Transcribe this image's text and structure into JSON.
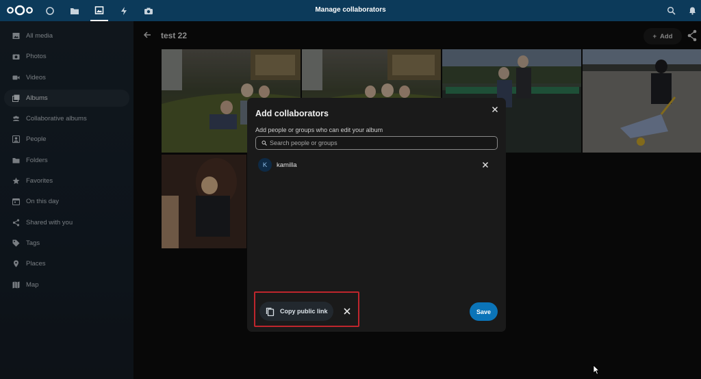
{
  "header": {
    "title": "Manage collaborators",
    "logo_icon": "nextcloud-logo",
    "apps": [
      {
        "name": "dashboard-icon",
        "active": false
      },
      {
        "name": "files-icon",
        "active": false
      },
      {
        "name": "photos-icon",
        "active": true
      },
      {
        "name": "activity-icon",
        "active": false
      },
      {
        "name": "camera-icon",
        "active": false
      }
    ],
    "right_icons": [
      "search-icon",
      "bell-icon"
    ]
  },
  "sidebar": {
    "items": [
      {
        "label": "All media",
        "icon": "image-icon",
        "active": false
      },
      {
        "label": "Photos",
        "icon": "camera-icon",
        "active": false
      },
      {
        "label": "Videos",
        "icon": "video-icon",
        "active": false
      },
      {
        "label": "Albums",
        "icon": "albums-icon",
        "active": true
      },
      {
        "label": "Collaborative albums",
        "icon": "group-icon",
        "active": false
      },
      {
        "label": "People",
        "icon": "people-icon",
        "active": false
      },
      {
        "label": "Folders",
        "icon": "folder-icon",
        "active": false
      },
      {
        "label": "Favorites",
        "icon": "star-icon",
        "active": false
      },
      {
        "label": "On this day",
        "icon": "calendar-icon",
        "active": false
      },
      {
        "label": "Shared with you",
        "icon": "share-icon",
        "active": false
      },
      {
        "label": "Tags",
        "icon": "tag-icon",
        "active": false
      },
      {
        "label": "Places",
        "icon": "pin-icon",
        "active": false
      },
      {
        "label": "Map",
        "icon": "map-icon",
        "active": false
      }
    ]
  },
  "album": {
    "title": "test 22",
    "add_label": "Add"
  },
  "modal": {
    "title": "Add collaborators",
    "subtitle": "Add people or groups who can edit your album",
    "search_placeholder": "Search people or groups",
    "search_value": "",
    "collaborators": [
      {
        "initial": "K",
        "name": "kamilla"
      }
    ],
    "copy_link_label": "Copy public link",
    "save_label": "Save"
  },
  "colors": {
    "header_bg": "#0c3a5a",
    "accent": "#0b74b8",
    "highlight_border": "#c0262d"
  }
}
